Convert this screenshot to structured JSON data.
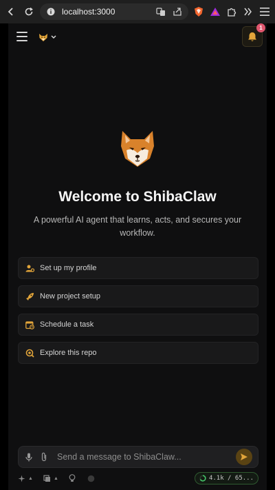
{
  "browser": {
    "url": "localhost:3000"
  },
  "header": {
    "notifications_count": "1"
  },
  "welcome": {
    "title": "Welcome to ShibaClaw",
    "subtitle": "A powerful AI agent that learns, acts, and secures your workflow."
  },
  "quick_actions": [
    {
      "label": "Set up my profile",
      "icon": "user-gear-icon"
    },
    {
      "label": "New project setup",
      "icon": "rocket-icon"
    },
    {
      "label": "Schedule a task",
      "icon": "calendar-clock-icon"
    },
    {
      "label": "Explore this repo",
      "icon": "search-icon"
    }
  ],
  "composer": {
    "placeholder": "Send a message to ShibaClaw..."
  },
  "token_usage": "4.1k / 65...",
  "colors": {
    "accent": "#e2a53a",
    "background": "#0f0f10",
    "card": "#19191a",
    "badge": "#e0566e",
    "token_ring": "#45c86a"
  }
}
